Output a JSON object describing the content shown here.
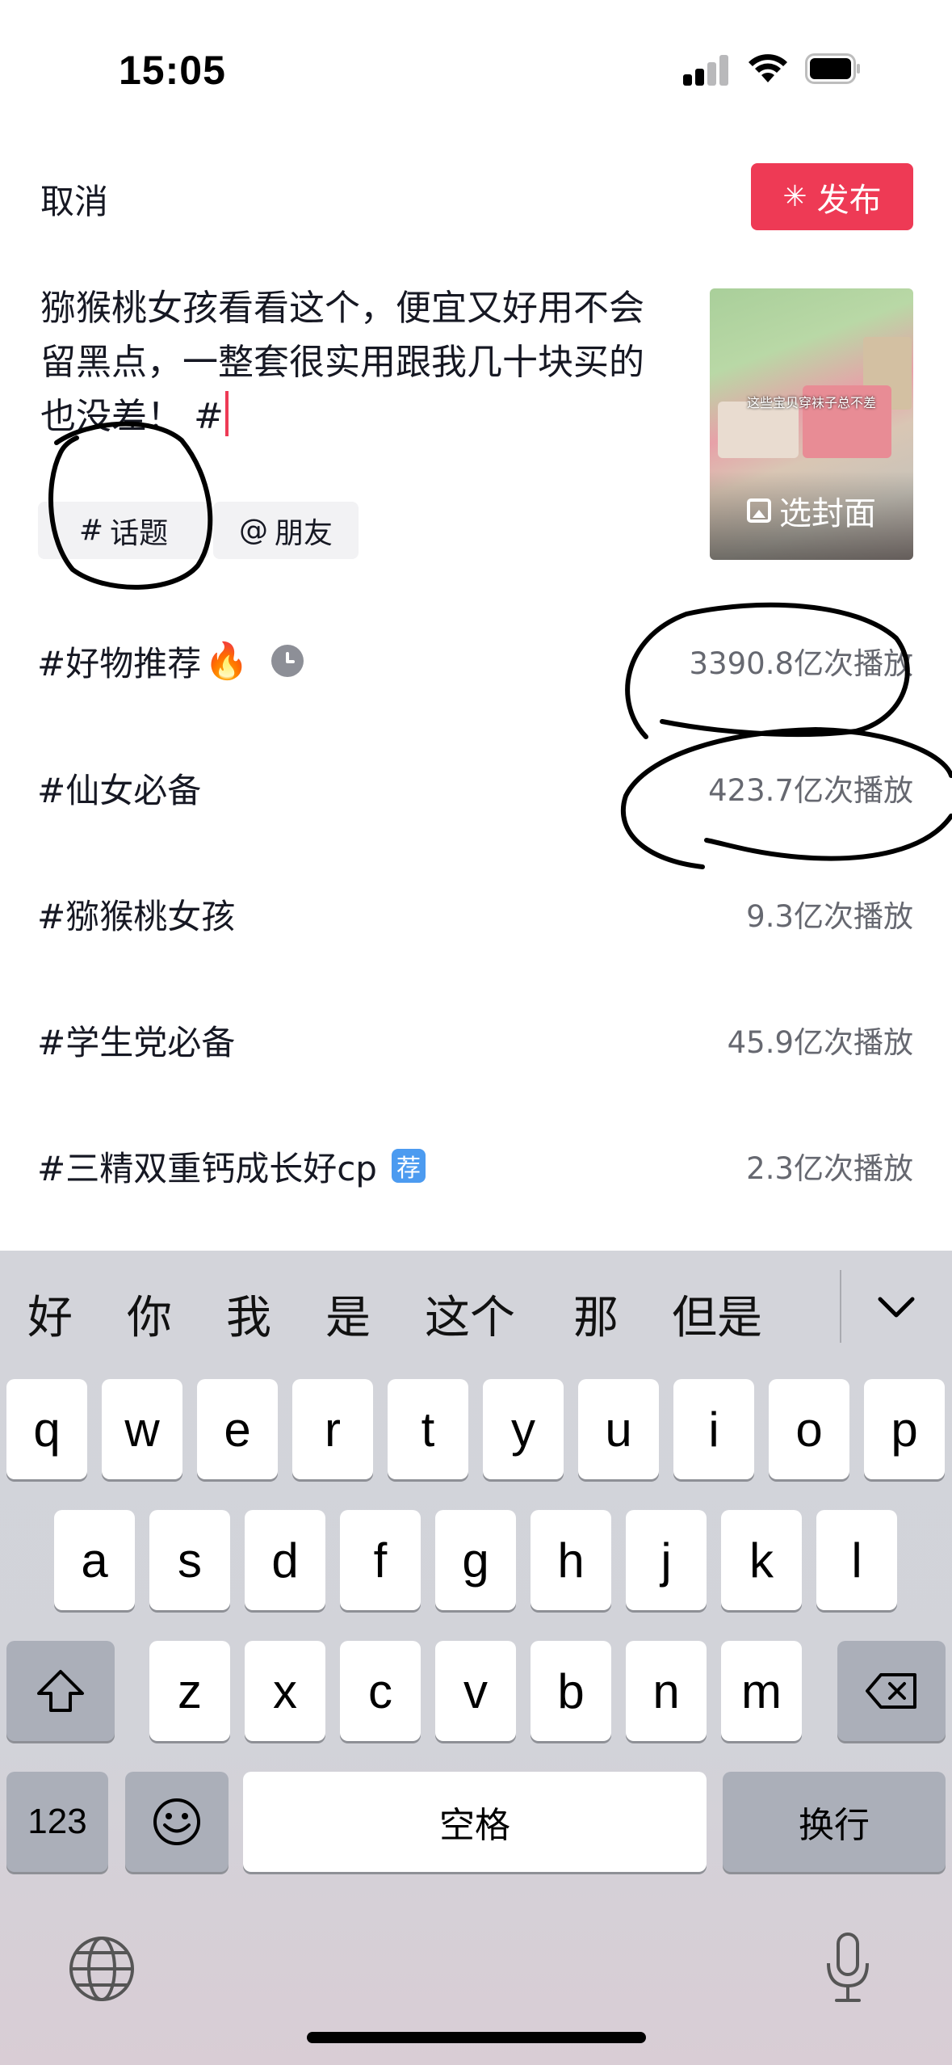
{
  "status_bar": {
    "time": "15:05"
  },
  "header": {
    "cancel_label": "取消",
    "publish_label": "发布"
  },
  "caption": {
    "text": "猕猴桃女孩看看这个，便宜又好用不会留黑点，一整套很实用跟我几十块买的也没差！ #"
  },
  "cover": {
    "label": "选封面",
    "image_text": "这些宝贝穿袜子总不差"
  },
  "chips": [
    {
      "icon": "#",
      "label": "话题"
    },
    {
      "icon": "@",
      "label": "朋友"
    }
  ],
  "topics": [
    {
      "name": "#好物推荐",
      "badge": "fire",
      "extra": "clock",
      "count": "3390.8亿次播放"
    },
    {
      "name": "#仙女必备",
      "count": "423.7亿次播放"
    },
    {
      "name": "#猕猴桃女孩",
      "count": "9.3亿次播放"
    },
    {
      "name": "#学生党必备",
      "count": "45.9亿次播放"
    },
    {
      "name": "#三精双重钙成长好cp",
      "badge": "荐",
      "count": "2.3亿次播放"
    }
  ],
  "keyboard": {
    "candidates": [
      "好",
      "你",
      "我",
      "是",
      "这个",
      "那",
      "但是"
    ],
    "row1": [
      "q",
      "w",
      "e",
      "r",
      "t",
      "y",
      "u",
      "i",
      "o",
      "p"
    ],
    "row2": [
      "a",
      "s",
      "d",
      "f",
      "g",
      "h",
      "j",
      "k",
      "l"
    ],
    "row3": [
      "z",
      "x",
      "c",
      "v",
      "b",
      "n",
      "m"
    ],
    "numbers_label": "123",
    "space_label": "空格",
    "return_label": "换行"
  },
  "colors": {
    "accent": "#ee3a55",
    "badge_blue": "#4c9bf0",
    "ink_annotation": "#000000"
  }
}
